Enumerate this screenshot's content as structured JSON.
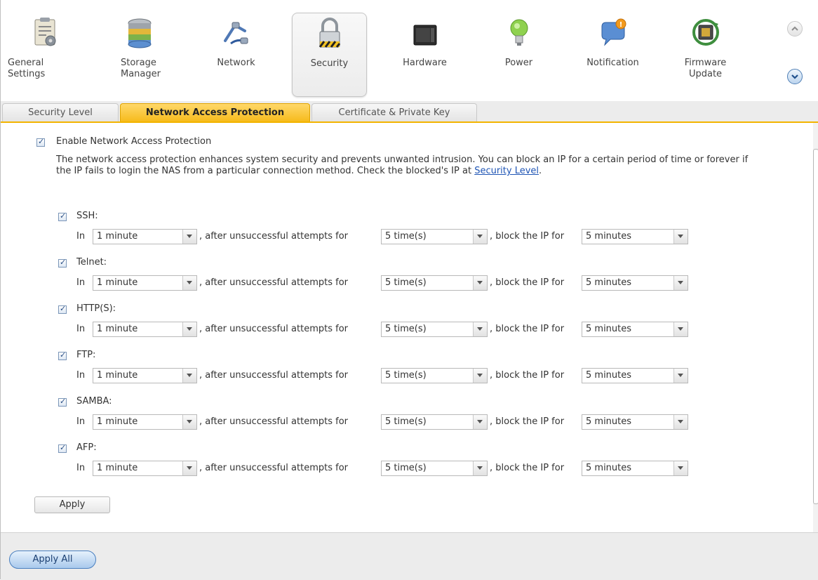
{
  "toolbar": {
    "items": [
      {
        "label": "General\nSettings",
        "icon": "general-settings-icon"
      },
      {
        "label": "Storage\nManager",
        "icon": "storage-manager-icon"
      },
      {
        "label": "Network",
        "icon": "network-icon"
      },
      {
        "label": "Security",
        "icon": "security-lock-icon",
        "active": true
      },
      {
        "label": "Hardware",
        "icon": "hardware-icon"
      },
      {
        "label": "Power",
        "icon": "power-bulb-icon"
      },
      {
        "label": "Notification",
        "icon": "notification-icon"
      },
      {
        "label": "Firmware\nUpdate",
        "icon": "firmware-update-icon"
      }
    ]
  },
  "tabs": [
    {
      "label": "Security Level"
    },
    {
      "label": "Network Access Protection",
      "active": true
    },
    {
      "label": "Certificate & Private Key"
    }
  ],
  "main": {
    "enable_label": "Enable Network Access Protection",
    "description": "The network access protection enhances system security and prevents unwanted intrusion. You can block an IP for a certain period of time or forever if the IP fails to login the NAS from a particular connection method. Check the blocked's IP at",
    "description_link": "Security Level",
    "description_end": ".",
    "rule_in": "In",
    "rule_mid": ", after unsuccessful attempts for",
    "rule_end": ", block the IP for",
    "protocols": [
      {
        "name": "SSH:",
        "period": "1 minute",
        "attempts": "5 time(s)",
        "block": "5 minutes"
      },
      {
        "name": "Telnet:",
        "period": "1 minute",
        "attempts": "5 time(s)",
        "block": "5 minutes"
      },
      {
        "name": "HTTP(S):",
        "period": "1 minute",
        "attempts": "5 time(s)",
        "block": "5 minutes"
      },
      {
        "name": "FTP:",
        "period": "1 minute",
        "attempts": "5 time(s)",
        "block": "5 minutes"
      },
      {
        "name": "SAMBA:",
        "period": "1 minute",
        "attempts": "5 time(s)",
        "block": "5 minutes"
      },
      {
        "name": "AFP:",
        "period": "1 minute",
        "attempts": "5 time(s)",
        "block": "5 minutes"
      }
    ],
    "apply_label": "Apply"
  },
  "footer": {
    "apply_all_label": "Apply All"
  },
  "colors": {
    "active_tab": "#f6bb1c",
    "link": "#1f55b5",
    "apply_all": "#a9c9ec"
  }
}
